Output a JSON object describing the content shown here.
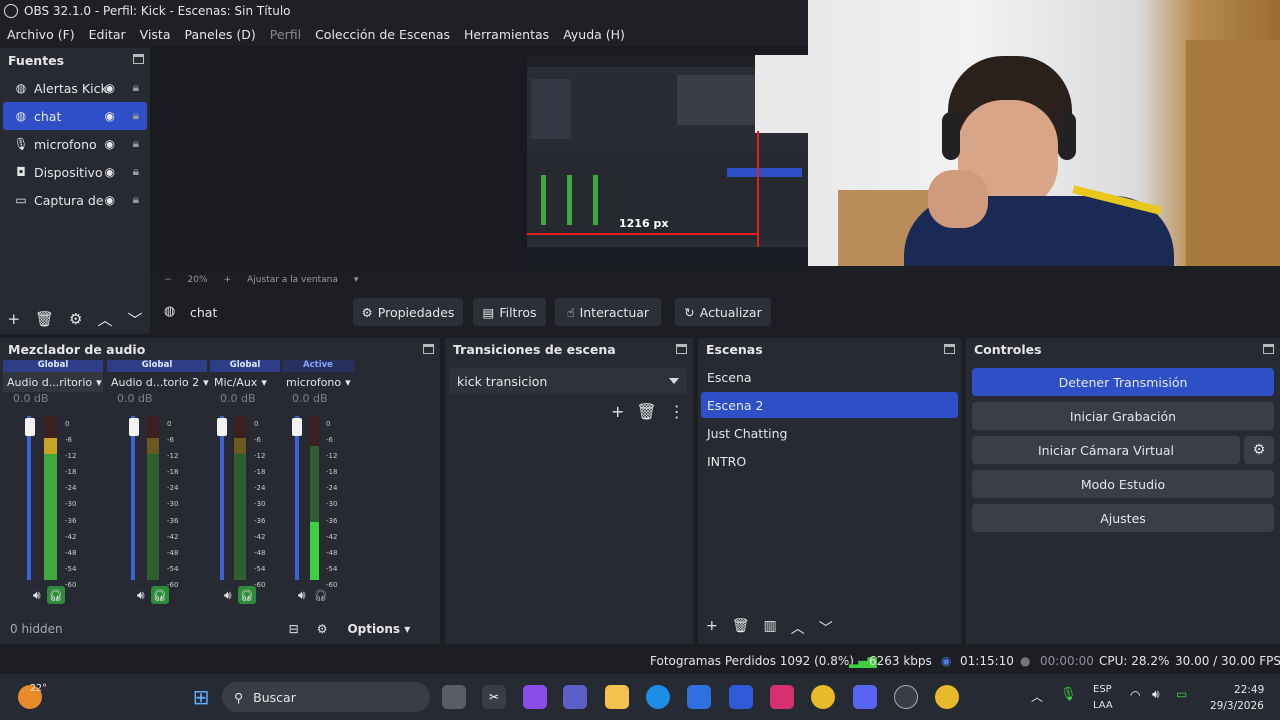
{
  "window": {
    "title": "OBS 32.1.0 - Perfil: Kick - Escenas: Sin Título"
  },
  "menu": {
    "file": "Archivo (F)",
    "edit": "Editar",
    "view": "Vista",
    "docks": "Paneles (D)",
    "profile": "Perfil",
    "scene_collection": "Colección de Escenas",
    "tools": "Herramientas",
    "help": "Ayuda (H)"
  },
  "sources": {
    "title": "Fuentes",
    "items": [
      {
        "label": "Alertas Kick",
        "icon": "globe-icon",
        "selected": false
      },
      {
        "label": "chat",
        "icon": "globe-icon",
        "selected": true
      },
      {
        "label": "microfono",
        "icon": "microphone-icon",
        "selected": false
      },
      {
        "label": "Dispositivo",
        "icon": "camera-icon",
        "selected": false
      },
      {
        "label": "Captura de",
        "icon": "monitor-icon",
        "selected": false
      }
    ]
  },
  "preview": {
    "zoom": "20%",
    "fit_label": "Ajustar a la ventana",
    "measure_label": "1216 px"
  },
  "context": {
    "source_name": "chat",
    "properties": "Propiedades",
    "filters": "Filtros",
    "interact": "Interactuar",
    "refresh": "Actualizar"
  },
  "mixer": {
    "title": "Mezclador de audio",
    "channels": [
      {
        "tag": "Global",
        "name": "Audio d...ritorio",
        "db": "0.0 dB",
        "monitor_on": true,
        "level": 0.82
      },
      {
        "tag": "Global",
        "name": "Audio d...torio 2",
        "db": "0.0 dB",
        "monitor_on": true,
        "level": 0.0
      },
      {
        "tag": "Global",
        "name": "Mic/Aux",
        "db": "0.0 dB",
        "monitor_on": true,
        "level": 0.0
      },
      {
        "tag": "Active",
        "name": "microfono",
        "db": "0.0 dB",
        "monitor_on": false,
        "level": 0.35
      }
    ],
    "scale": [
      "0",
      "-6",
      "-12",
      "-18",
      "-24",
      "-30",
      "-36",
      "-42",
      "-48",
      "-54",
      "-60"
    ],
    "hidden_label": "0 hidden",
    "options_label": "Options"
  },
  "transitions": {
    "title": "Transiciones de escena",
    "selected": "kick transicion"
  },
  "scenes": {
    "title": "Escenas",
    "items": [
      {
        "label": "Escena",
        "selected": false
      },
      {
        "label": "Escena 2",
        "selected": true
      },
      {
        "label": "Just Chatting",
        "selected": false
      },
      {
        "label": "INTRO",
        "selected": false
      }
    ]
  },
  "controls": {
    "title": "Controles",
    "stop_stream": "Detener Transmisión",
    "start_recording": "Iniciar Grabación",
    "start_virtual_cam": "Iniciar Cámara Virtual",
    "studio_mode": "Modo Estudio",
    "settings": "Ajustes"
  },
  "status": {
    "dropped": "Fotogramas Perdidos 1092 (0.8%)",
    "bitrate": "6263 kbps",
    "live_time": "01:15:10",
    "rec_time": "00:00:00",
    "cpu": "CPU: 28.2%",
    "fps": "30.00 / 30.00 FPS"
  },
  "taskbar": {
    "temp": "22°",
    "search_placeholder": "Buscar",
    "lang_top": "ESP",
    "lang_bottom": "LAA",
    "time": "22:49",
    "date": "29/3/2026"
  },
  "colors": {
    "accent": "#2f4fc7",
    "meter_green": "#3fa83f",
    "meter_yellow": "#c8a326",
    "meter_red": "#b43030",
    "slider": "#3b62d8"
  }
}
